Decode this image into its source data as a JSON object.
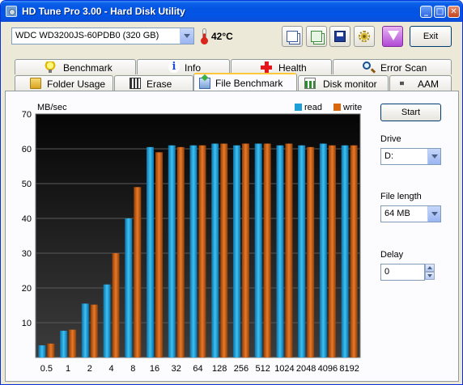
{
  "window": {
    "title": "HD Tune Pro 3.00 - Hard Disk Utility",
    "controls": [
      "_",
      "□",
      "✕"
    ]
  },
  "toolbar": {
    "drive": "WDC WD3200JS-60PDB0 (320 GB)",
    "temperature": "42°C",
    "exit_label": "Exit",
    "icons": [
      "copy-text-icon",
      "copy-screenshot-icon",
      "save-icon",
      "options-gear-icon",
      "download-arrow-icon"
    ]
  },
  "tabs": {
    "row1": [
      {
        "label": "Benchmark",
        "icon": "bulb-icon"
      },
      {
        "label": "Info",
        "icon": "info-icon"
      },
      {
        "label": "Health",
        "icon": "health-cross-icon"
      },
      {
        "label": "Error Scan",
        "icon": "magnifier-icon"
      }
    ],
    "row2": [
      {
        "label": "Folder Usage",
        "icon": "folder-icon"
      },
      {
        "label": "Erase",
        "icon": "erase-icon"
      },
      {
        "label": "File Benchmark",
        "icon": "file-benchmark-icon",
        "active": true
      },
      {
        "label": "Disk monitor",
        "icon": "disk-monitor-icon"
      },
      {
        "label": "AAM",
        "icon": "speaker-icon"
      }
    ]
  },
  "side": {
    "start_label": "Start",
    "drive_label": "Drive",
    "drive_value": "D:",
    "file_length_label": "File length",
    "file_length_value": "64 MB",
    "delay_label": "Delay",
    "delay_value": "0"
  },
  "chart_data": {
    "type": "bar",
    "ylabel": "MB/sec",
    "ylim": [
      0,
      70
    ],
    "yticks": [
      10,
      20,
      30,
      40,
      50,
      60,
      70
    ],
    "categories": [
      "0.5",
      "1",
      "2",
      "4",
      "8",
      "16",
      "32",
      "64",
      "128",
      "256",
      "512",
      "1024",
      "2048",
      "4096",
      "8192"
    ],
    "series": [
      {
        "name": "read",
        "color": "#1f9fd8",
        "values": [
          3.5,
          7.7,
          15.5,
          21,
          40,
          60.5,
          61,
          61,
          61.5,
          61,
          61.5,
          61,
          61,
          61.5,
          61
        ]
      },
      {
        "name": "write",
        "color": "#d8670f",
        "values": [
          4,
          8,
          15.2,
          30,
          49,
          59,
          60.5,
          61,
          61.5,
          61.5,
          61.5,
          61.5,
          60.5,
          61,
          61
        ]
      }
    ],
    "legend_position": "top-right",
    "grid": true,
    "background": "dark"
  }
}
